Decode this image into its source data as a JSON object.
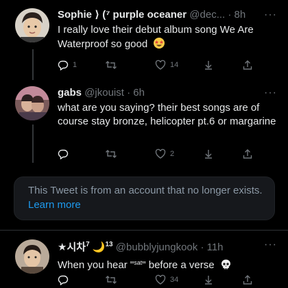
{
  "tweets": [
    {
      "name": "Sophie",
      "name_symbols": "⟩ (⁷ purple oceaner",
      "handle": "@dec...",
      "dot": "·",
      "time": "8h",
      "more": "···",
      "text": "I really love their debut album song We Are Waterproof so good",
      "emoji": "star-struck-face-icon",
      "replies": "1",
      "retweets": "",
      "likes": "14"
    },
    {
      "name": "gabs",
      "handle": "@jkouist",
      "dot": "·",
      "time": "6h",
      "more": "···",
      "text": "what are you saying? their best songs are of course stay bronze, helicopter pt.6 or margarine",
      "replies": "",
      "retweets": "",
      "likes": "2"
    },
    {
      "name": "★시차",
      "name_sup": "7",
      "name_moon": "🌙",
      "name_suffix": "13",
      "handle": "@bubblyjungkook",
      "dot": "·",
      "time": "11h",
      "more": "···",
      "text_before": "When you hear \"",
      "text_small": "sat",
      "text_after": "\" before a verse",
      "emoji": "skull-icon",
      "replies": "",
      "retweets": "",
      "likes": "34"
    }
  ],
  "deleted": {
    "text": "This Tweet is from an account that no longer exists.",
    "link": "Learn more"
  },
  "colors": {
    "background": "#000000",
    "text": "#e7e9ea",
    "muted": "#71767b",
    "link": "#1d9bf0",
    "box": "#16181c"
  }
}
